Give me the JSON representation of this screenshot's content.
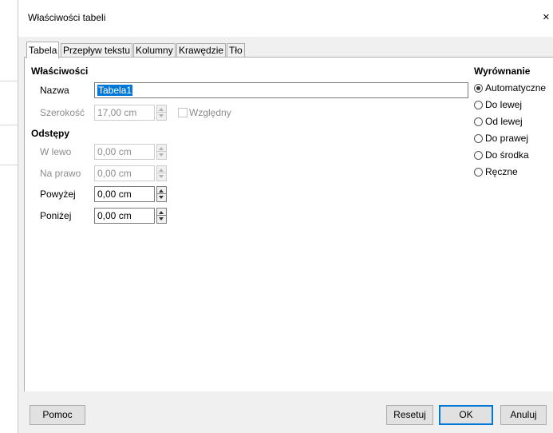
{
  "window": {
    "title": "Właściwości tabeli",
    "close_glyph": "×"
  },
  "tabs": [
    {
      "label": "Tabela",
      "active": true
    },
    {
      "label": "Przepływ tekstu"
    },
    {
      "label": "Kolumny"
    },
    {
      "label": "Krawędzie"
    },
    {
      "label": "Tło"
    }
  ],
  "properties": {
    "heading": "Właściwości",
    "name_label": "Nazwa",
    "name_value": "Tabela1",
    "width_label": "Szerokość",
    "width_value": "17,00 cm",
    "relative_label": "Względny"
  },
  "spacing": {
    "heading": "Odstępy",
    "left_label": "W lewo",
    "left_value": "0,00 cm",
    "right_label": "Na prawo",
    "right_value": "0,00 cm",
    "above_label": "Powyżej",
    "above_value": "0,00 cm",
    "below_label": "Poniżej",
    "below_value": "0,00 cm"
  },
  "alignment": {
    "heading": "Wyrównanie",
    "options": [
      {
        "label": "Automatyczne",
        "selected": true
      },
      {
        "label": "Do lewej"
      },
      {
        "label": "Od lewej"
      },
      {
        "label": "Do prawej"
      },
      {
        "label": "Do środka"
      },
      {
        "label": "Ręczne"
      }
    ]
  },
  "buttons": {
    "help": "Pomoc",
    "reset": "Resetuj",
    "ok": "OK",
    "cancel": "Anuluj"
  }
}
